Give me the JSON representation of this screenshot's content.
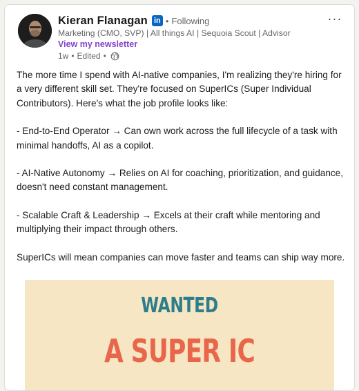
{
  "author": {
    "name": "Kieran Flanagan",
    "badge": "in",
    "follow_status": "Following",
    "headline": "Marketing (CMO, SVP) | All things AI | Sequoia Scout | Advisor",
    "newsletter_link": "View my newsletter",
    "time": "1w",
    "edited": "Edited",
    "visibility_icon": "globe-icon"
  },
  "post": {
    "paragraphs": [
      "The more time I spend with AI-native companies, I'm realizing they're hiring for a very different skill set. They're focused on SuperICs (Super Individual Contributors). Here's what the job profile looks like:",
      "- End-to-End Operator → Can own work across the full lifecycle of a task with minimal handoffs, AI as a copilot.",
      "- AI-Native Autonomy → Relies on AI for coaching, prioritization, and guidance, doesn't need constant management.",
      "- Scalable Craft & Leadership → Excels at their craft while mentoring and multiplying their impact through others.",
      "SuperICs will mean companies can move faster and teams can ship way more."
    ],
    "image": {
      "line1": "WANTED",
      "line2": "A SUPER IC",
      "background": "#f7e6c3",
      "line1_color": "#2d7e8a",
      "line2_color": "#e8664a"
    }
  },
  "controls": {
    "more_icon": "more-icon",
    "more_label": "···"
  },
  "colors": {
    "linkedin_blue": "#0a66c2",
    "newsletter_purple": "#8344cc",
    "muted": "#666666"
  }
}
